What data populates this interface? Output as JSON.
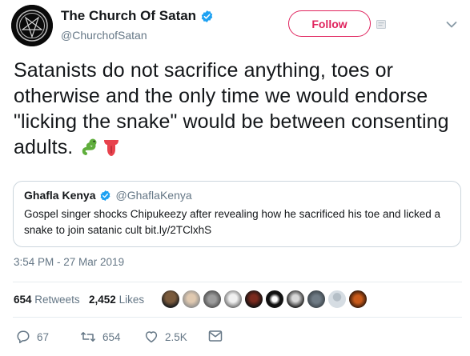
{
  "header": {
    "display_name": "The Church Of Satan",
    "handle": "@ChurchofSatan",
    "follow_label": "Follow"
  },
  "tweet": {
    "text": "Satanists do not sacrifice anything, toes or otherwise and the only time we would endorse \"licking the snake\" would be between consenting adults.",
    "emojis": [
      "snake-emoji",
      "tongue-emoji"
    ]
  },
  "quote": {
    "display_name": "Ghafla Kenya",
    "handle": "@GhaflaKenya",
    "text": "Gospel singer shocks Chipukeezy after revealing how he sacrificed his toe and licked a snake to join satanic cult bit.ly/2TClxhS"
  },
  "timestamp": "3:54 PM - 27 Mar 2019",
  "stats": {
    "retweets_count": "654",
    "retweets_label": "Retweets",
    "likes_count": "2,452",
    "likes_label": "Likes"
  },
  "actions": {
    "reply_count": "67",
    "retweet_count": "654",
    "like_count": "2.5K"
  },
  "colors": {
    "follow_accent": "#e0245e",
    "secondary_text": "#657786",
    "verified_blue": "#1da1f2",
    "border": "#ccd6dd"
  }
}
